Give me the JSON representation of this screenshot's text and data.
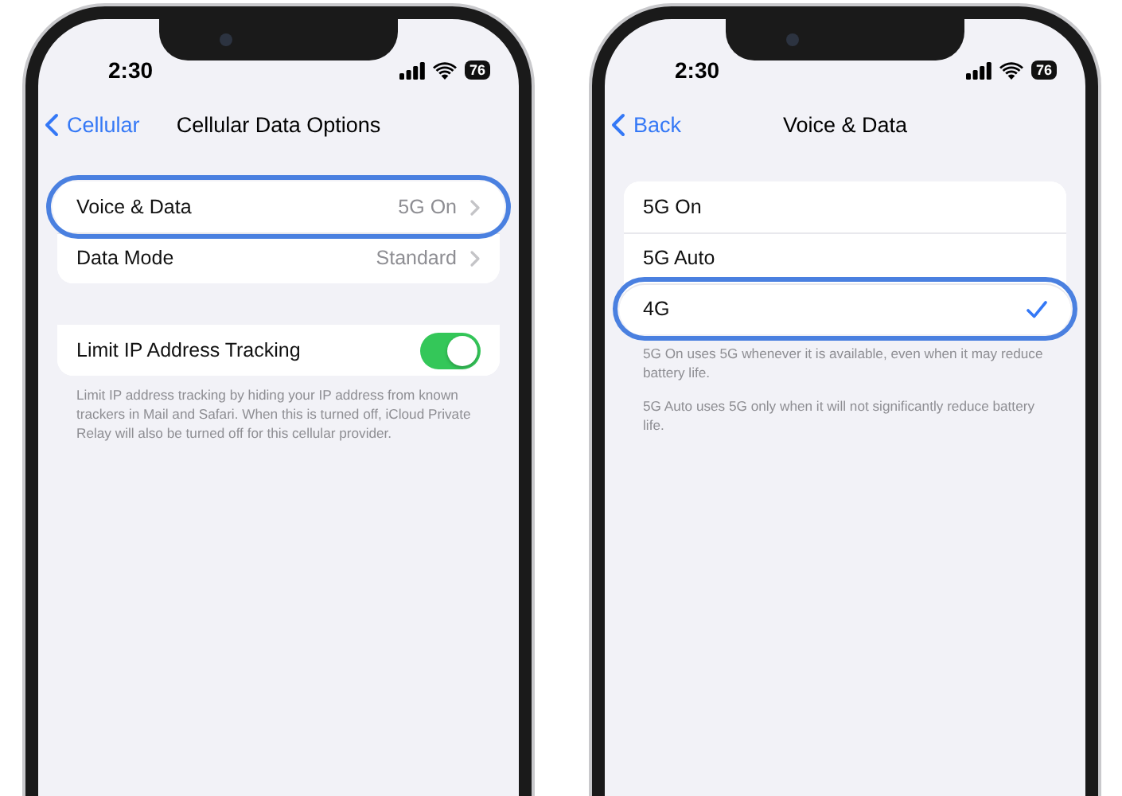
{
  "phones": [
    {
      "status_bar": {
        "time": "2:30",
        "battery": "76"
      },
      "nav": {
        "back": "Cellular",
        "title": "Cellular Data Options"
      },
      "sections": [
        {
          "rows": [
            {
              "kind": "disclosure",
              "label": "Voice & Data",
              "value": "5G On",
              "highlighted": true
            },
            {
              "kind": "disclosure",
              "label": "Data Mode",
              "value": "Standard",
              "highlighted": false
            }
          ]
        },
        {
          "rows": [
            {
              "kind": "toggle",
              "label": "Limit IP Address Tracking",
              "on": true,
              "highlighted": false
            }
          ],
          "footers": [
            "Limit IP address tracking by hiding your IP address from known trackers in Mail and Safari. When this is turned off, iCloud Private Relay will also be turned off for this cellular provider."
          ]
        }
      ]
    },
    {
      "status_bar": {
        "time": "2:30",
        "battery": "76"
      },
      "nav": {
        "back": "Back",
        "title": "Voice & Data"
      },
      "sections": [
        {
          "rows": [
            {
              "kind": "option",
              "label": "5G On",
              "selected": false,
              "highlighted": false
            },
            {
              "kind": "option",
              "label": "5G Auto",
              "selected": false,
              "highlighted": false
            },
            {
              "kind": "option",
              "label": "4G",
              "selected": true,
              "highlighted": true
            }
          ],
          "footers": [
            "5G On uses 5G whenever it is available, even when it may reduce battery life.",
            "5G Auto uses 5G only when it will not significantly reduce battery life."
          ]
        }
      ]
    }
  ]
}
